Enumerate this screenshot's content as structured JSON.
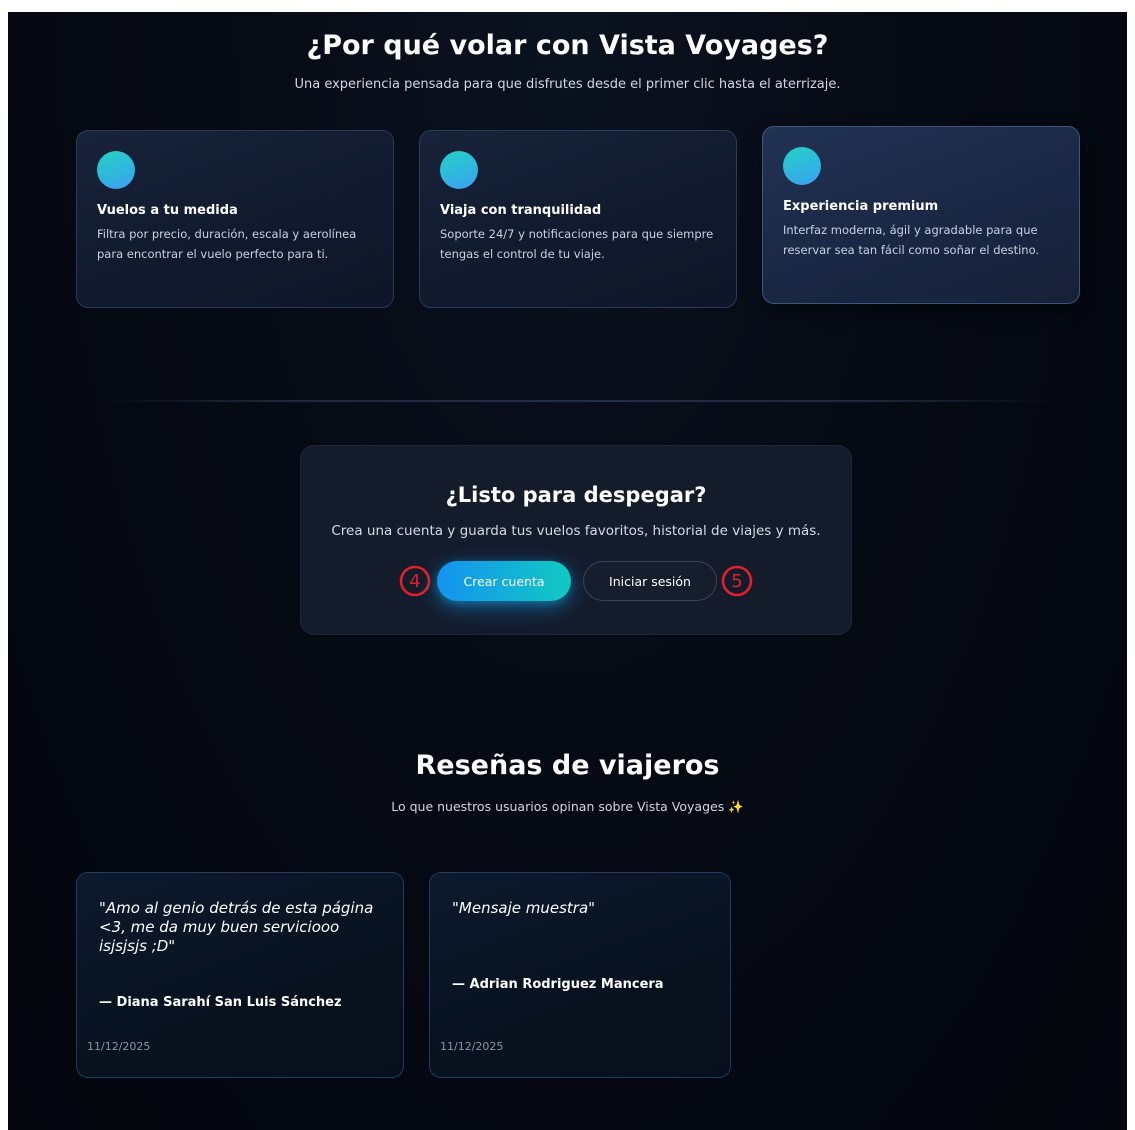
{
  "why": {
    "title": "¿Por qué volar con Vista Voyages?",
    "subtitle": "Una experiencia pensada para que disfrutes desde el primer clic hasta el aterrizaje."
  },
  "features": [
    {
      "title": "Vuelos a tu medida",
      "description": "Filtra por precio, duración, escala y aerolínea para encontrar el vuelo perfecto para ti."
    },
    {
      "title": "Viaja con tranquilidad",
      "description": "Soporte 24/7 y notificaciones para que siempre tengas el control de tu viaje."
    },
    {
      "title": "Experiencia premium",
      "description": "Interfaz moderna, ágil y agradable para que reservar sea tan fácil como soñar el destino."
    }
  ],
  "cta": {
    "title": "¿Listo para despegar?",
    "subtitle": "Crea una cuenta y guarda tus vuelos favoritos, historial de viajes y más.",
    "primary_label": "Crear cuenta",
    "secondary_label": "Iniciar sesión"
  },
  "callouts": {
    "left": "4",
    "right": "5",
    "color": "#e0202a"
  },
  "reviews": {
    "title": "Reseñas de viajeros",
    "subtitle": "Lo que nuestros usuarios opinan sobre Vista Voyages ✨",
    "items": [
      {
        "quote": "\"Amo al genio detrás de esta página <3, me da muy buen serviciooo isjsjsjs ;D\"",
        "author": "— Diana Sarahí San Luis Sánchez",
        "date": "11/12/2025"
      },
      {
        "quote": "\"Mensaje muestra\"",
        "author": "— Adrian Rodriguez Mancera",
        "date": "11/12/2025"
      }
    ]
  },
  "colors": {
    "background": "#060a14",
    "card": "#141b2b",
    "accent_start": "#1493f0",
    "accent_end": "#11c9c2",
    "review_border": "#1e3a66"
  }
}
